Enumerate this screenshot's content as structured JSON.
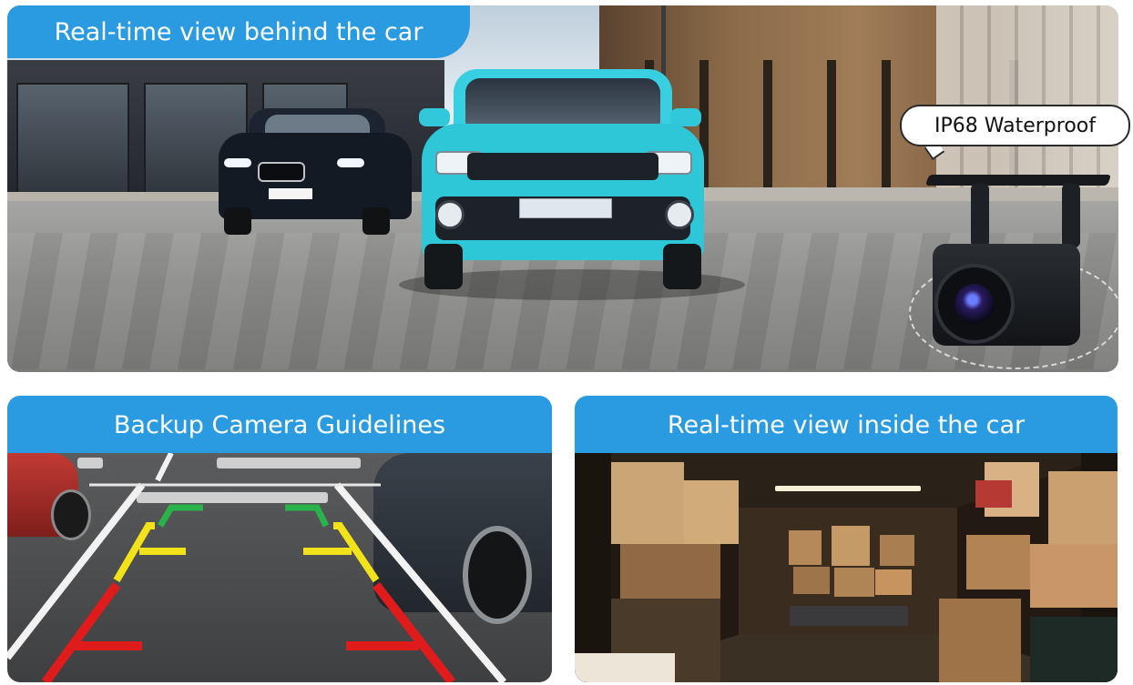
{
  "top_panel": {
    "label": "Real-time view behind the car",
    "callout": "IP68 Waterproof"
  },
  "bottom_left_panel": {
    "label": "Backup Camera Guidelines",
    "guideline_colors": {
      "near": "#e01b1b",
      "mid": "#f2e21a",
      "far": "#29b34a"
    }
  },
  "bottom_right_panel": {
    "label": "Real-time view inside the car"
  },
  "colors": {
    "label_bg": "#2a9be0",
    "label_text": "#ffffff",
    "car_teal": "#2dc7d8"
  }
}
